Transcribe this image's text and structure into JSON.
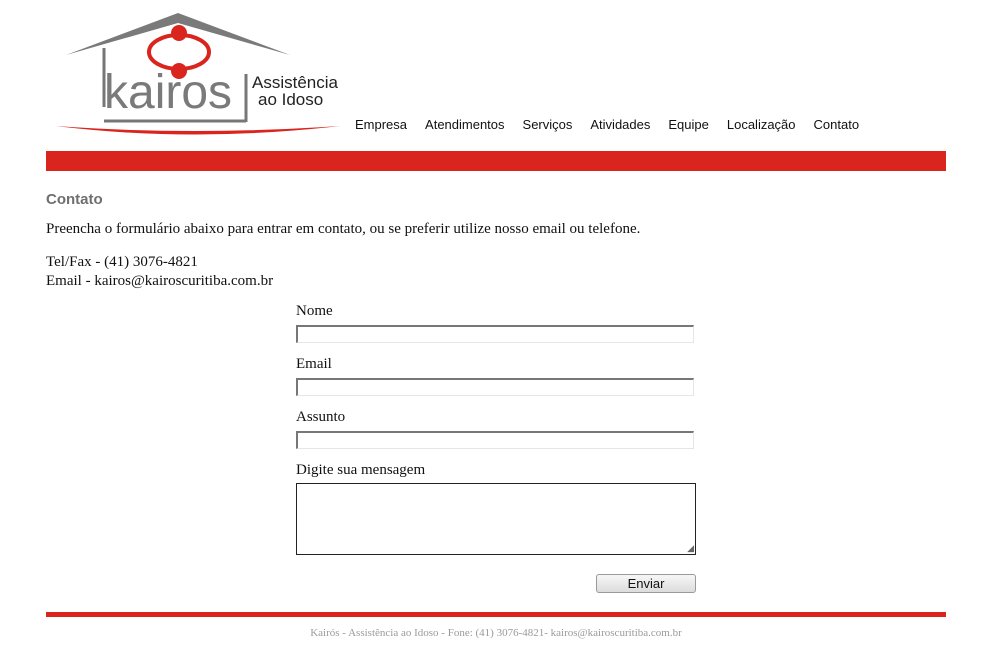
{
  "brand": {
    "name": "kairos",
    "tagline_1": "Assistência",
    "tagline_2": "ao Idoso"
  },
  "nav": [
    "Empresa",
    "Atendimentos",
    "Serviços",
    "Atividades",
    "Equipe",
    "Localização",
    "Contato"
  ],
  "colors": {
    "accent": "#d9251d",
    "logo_gray": "#777777",
    "title_gray": "#6f6f6f"
  },
  "page": {
    "title": "Contato",
    "intro": "Preencha o formulário abaixo para entrar em contato, ou se preferir utilize nosso email ou telefone.",
    "phone": "Tel/Fax - (41) 3076-4821",
    "email": "Email - kairos@kairoscuritiba.com.br"
  },
  "form": {
    "name_label": "Nome",
    "name_value": "",
    "email_label": "Email",
    "email_value": "",
    "subject_label": "Assunto",
    "subject_value": "",
    "message_label": "Digite sua mensagem",
    "message_value": "",
    "submit_label": "Enviar"
  },
  "footer": {
    "text": "Kairós - Assistência ao Idoso - Fone: (41) 3076-4821- kairos@kairoscuritiba.com.br"
  }
}
